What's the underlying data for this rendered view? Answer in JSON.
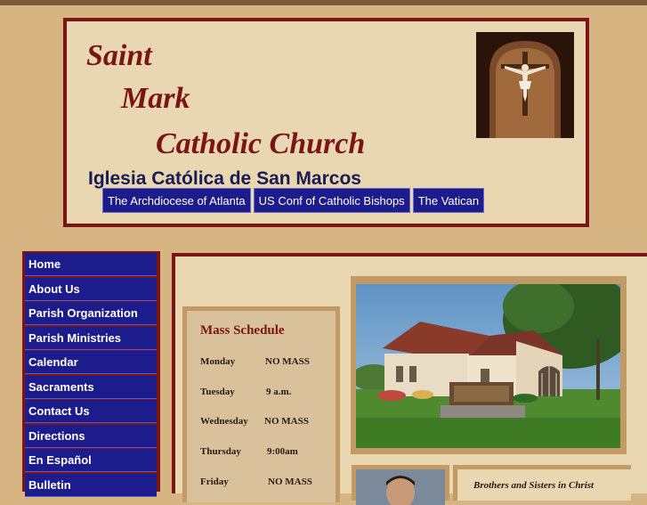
{
  "header": {
    "title_line1": "Saint",
    "title_line2": "Mark",
    "title_line3": "Catholic Church",
    "spanish_title": "Iglesia Católica de San Marcos",
    "external_links": [
      {
        "label": "The Archdiocese of Atlanta"
      },
      {
        "label": "US Conf of Catholic Bishops"
      },
      {
        "label": "The Vatican"
      }
    ]
  },
  "sidebar": {
    "items": [
      {
        "label": "Home"
      },
      {
        "label": "About Us"
      },
      {
        "label": "Parish Organization"
      },
      {
        "label": "Parish Ministries"
      },
      {
        "label": "Calendar"
      },
      {
        "label": "Sacraments"
      },
      {
        "label": "Contact Us"
      },
      {
        "label": "Directions"
      },
      {
        "label": "En Español"
      },
      {
        "label": "Bulletin"
      }
    ]
  },
  "mass_schedule": {
    "title": "Mass Schedule",
    "rows": [
      {
        "day": "Monday",
        "time": "NO MASS"
      },
      {
        "day": "Tuesday",
        "time": "9 a.m."
      },
      {
        "day": "Wednesday",
        "time": "NO MASS"
      },
      {
        "day": "Thursday",
        "time": "9:00am"
      },
      {
        "day": "Friday",
        "time": "NO MASS"
      }
    ]
  },
  "greeting": {
    "text": "Brothers and Sisters in Christ"
  },
  "colors": {
    "page_bg": "#d6b583",
    "frame": "#7b1414",
    "panel": "#e8d7b0",
    "nav": "#1c1c8c",
    "title": "#7b1414"
  }
}
